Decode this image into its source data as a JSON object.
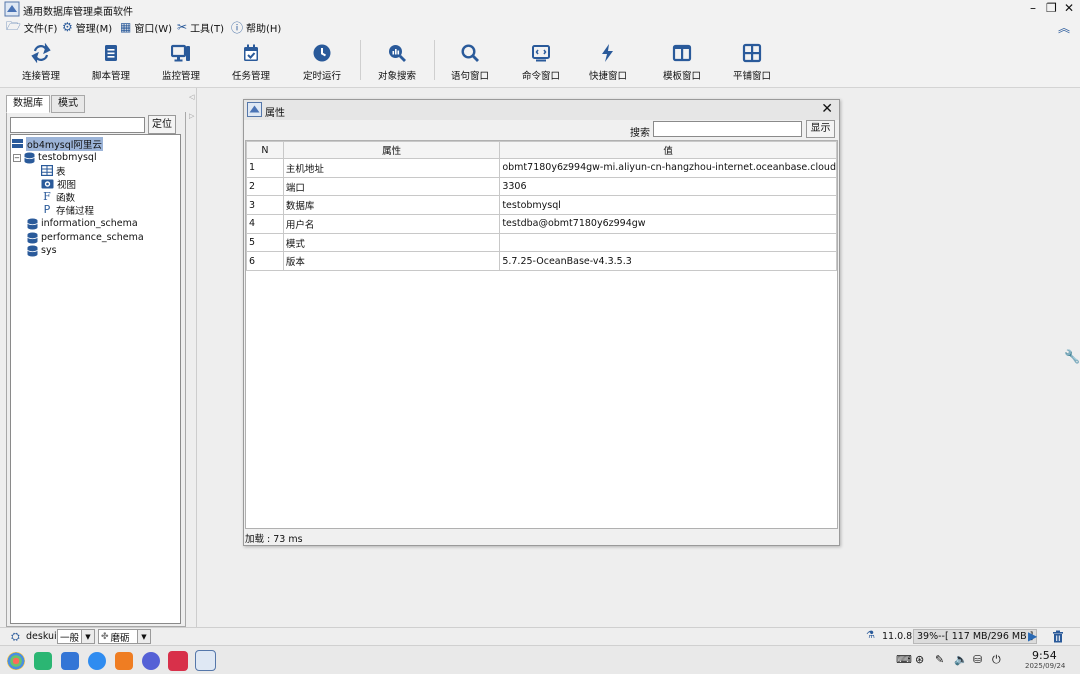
{
  "window": {
    "title": "通用数据库管理桌面软件",
    "minimize": "–",
    "maximize": "❐",
    "close": "✕"
  },
  "menu": [
    {
      "label": "文件(F)",
      "icon": "folder-icon"
    },
    {
      "label": "管理(M)",
      "icon": "gear-icon"
    },
    {
      "label": "窗口(W)",
      "icon": "windows-icon"
    },
    {
      "label": "工具(T)",
      "icon": "tools-icon"
    },
    {
      "label": "帮助(H)",
      "icon": "help-icon"
    }
  ],
  "toolbar": [
    {
      "label": "连接管理",
      "icon": "sync-icon"
    },
    {
      "label": "脚本管理",
      "icon": "script-icon"
    },
    {
      "label": "监控管理",
      "icon": "monitor-icon"
    },
    {
      "label": "任务管理",
      "icon": "calendar-icon"
    },
    {
      "label": "定时运行",
      "icon": "clock-icon"
    },
    {
      "label": "对象搜索",
      "icon": "search-chart-icon"
    },
    {
      "label": "语句窗口",
      "icon": "search-icon"
    },
    {
      "label": "命令窗口",
      "icon": "terminal-icon"
    },
    {
      "label": "快捷窗口",
      "icon": "lightning-icon"
    },
    {
      "label": "模板窗口",
      "icon": "columns-icon"
    },
    {
      "label": "平铺窗口",
      "icon": "grid-icon"
    }
  ],
  "left_tabs": [
    "数据库",
    "模式"
  ],
  "locate_label": "定位",
  "tree": [
    {
      "label": "ob4mysql阿里云",
      "level": 0,
      "selected": true,
      "icon": "server-icon"
    },
    {
      "label": "testobmysql",
      "level": 1,
      "expanded": true,
      "icon": "database-icon"
    },
    {
      "label": "表",
      "level": 2,
      "icon": "table-icon"
    },
    {
      "label": "视图",
      "level": 2,
      "icon": "view-icon"
    },
    {
      "label": "函数",
      "level": 2,
      "icon": "function-icon"
    },
    {
      "label": "存储过程",
      "level": 2,
      "icon": "procedure-icon"
    },
    {
      "label": "information_schema",
      "level": 1,
      "icon": "database-icon"
    },
    {
      "label": "performance_schema",
      "level": 1,
      "icon": "database-icon"
    },
    {
      "label": "sys",
      "level": 1,
      "icon": "database-icon"
    }
  ],
  "dialog": {
    "title": "属性",
    "close": "✕",
    "search_label": "搜索",
    "show_button": "显示",
    "columns": [
      "N",
      "属性",
      "值"
    ],
    "rows": [
      [
        "1",
        "主机地址",
        "obmt7180y6z994gw-mi.aliyun-cn-hangzhou-internet.oceanbase.cloud"
      ],
      [
        "2",
        "端口",
        "3306"
      ],
      [
        "3",
        "数据库",
        "testobmysql"
      ],
      [
        "4",
        "用户名",
        "testdba@obmt7180y6z994gw"
      ],
      [
        "5",
        "模式",
        ""
      ],
      [
        "6",
        "版本",
        "5.7.25-OceanBase-v4.3.5.3"
      ]
    ],
    "status": "加载 : 73 ms"
  },
  "statusbar": {
    "user": "deskui",
    "mode": "一般",
    "skin": "磨砺",
    "version": "11.0.8",
    "memory": "39%--[ 117 MB/296 MB ]"
  },
  "taskbar": {
    "time": "9:54",
    "date": "2025/09/24"
  }
}
